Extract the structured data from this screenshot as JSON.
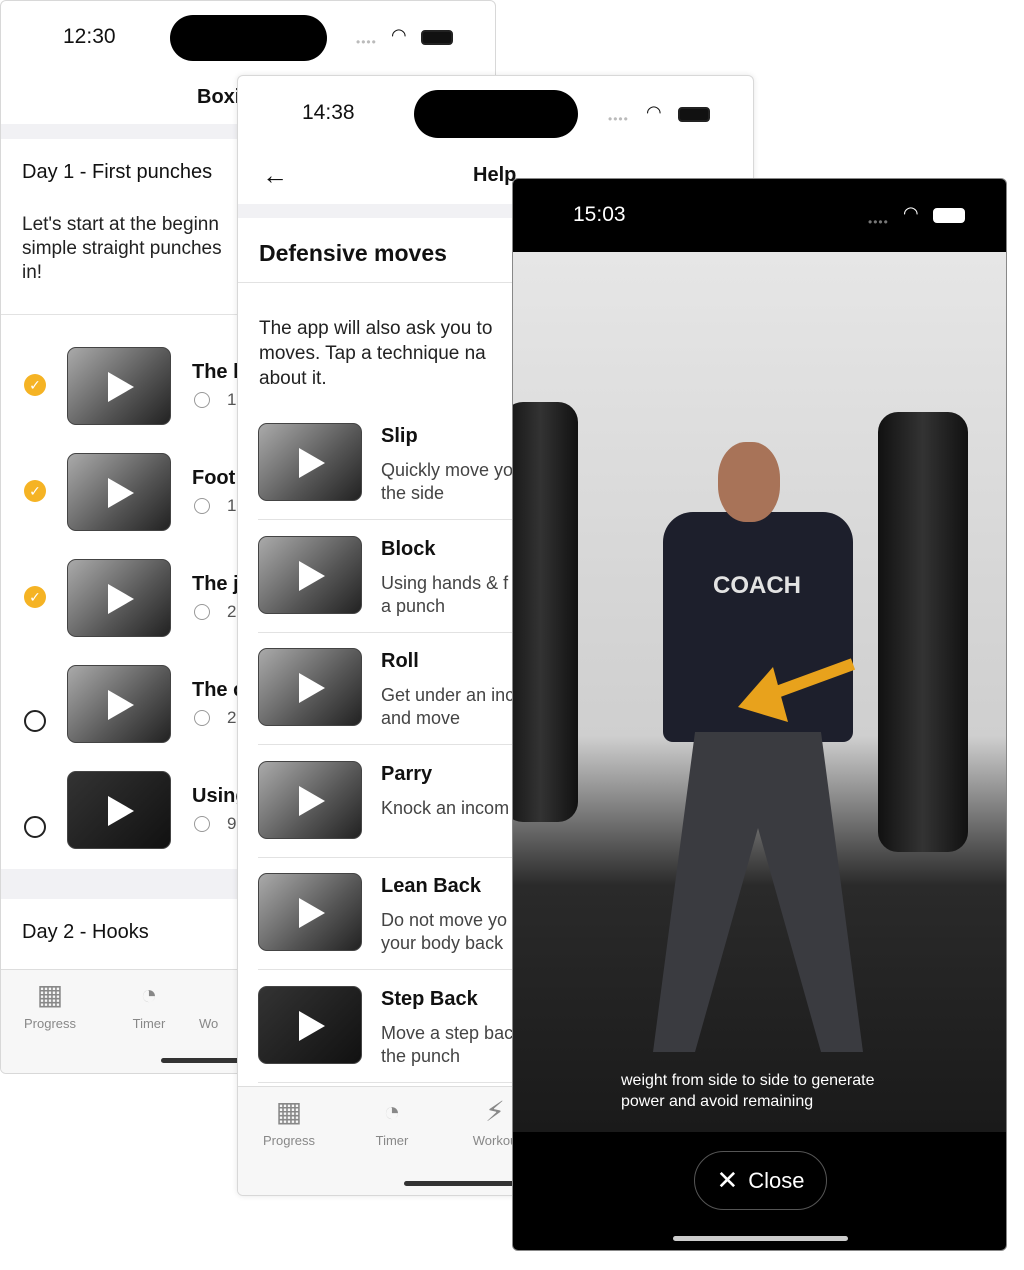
{
  "screen1": {
    "time": "12:30",
    "title": "Boxi",
    "day1_title": "Day 1 - First punches",
    "day1_desc": "Let's start at the beginn simple straight punches in!",
    "lessons": [
      {
        "title": "The l",
        "meta": "1",
        "done": true
      },
      {
        "title": "Foot",
        "meta": "1",
        "done": true
      },
      {
        "title": "The j",
        "meta": "2",
        "done": true
      },
      {
        "title": "The c",
        "meta": "2",
        "done": false
      },
      {
        "title": "Using",
        "meta": "9",
        "done": false
      }
    ],
    "day2_title": "Day 2 - Hooks",
    "tabs": [
      {
        "label": "Progress",
        "icon": "calendar-icon"
      },
      {
        "label": "Timer",
        "icon": "timer-icon"
      },
      {
        "label": "Wo",
        "icon": "lightning-icon"
      }
    ]
  },
  "screen2": {
    "time": "14:38",
    "title": "Help",
    "section": "Defensive moves",
    "intro": "The app will also ask you to moves. Tap a technique na about it.",
    "moves": [
      {
        "title": "Slip",
        "desc": "Quickly move yo the side"
      },
      {
        "title": "Block",
        "desc": "Using hands & f a punch"
      },
      {
        "title": "Roll",
        "desc": "Get under an inc and move"
      },
      {
        "title": "Parry",
        "desc": "Knock an incom"
      },
      {
        "title": "Lean Back",
        "desc": "Do not move yo your body back"
      },
      {
        "title": "Step Back",
        "desc": "Move a step bac the punch"
      }
    ],
    "tabs": [
      {
        "label": "Progress",
        "icon": "calendar-icon"
      },
      {
        "label": "Timer",
        "icon": "timer-icon"
      },
      {
        "label": "Workou",
        "icon": "lightning-icon"
      }
    ]
  },
  "screen3": {
    "time": "15:03",
    "subtitle": "weight from side to side to generate power and avoid remaining",
    "close_label": "Close",
    "shirt_text": "COACH",
    "accent": "#e8a21c"
  },
  "colors": {
    "check": "#f5b324"
  }
}
